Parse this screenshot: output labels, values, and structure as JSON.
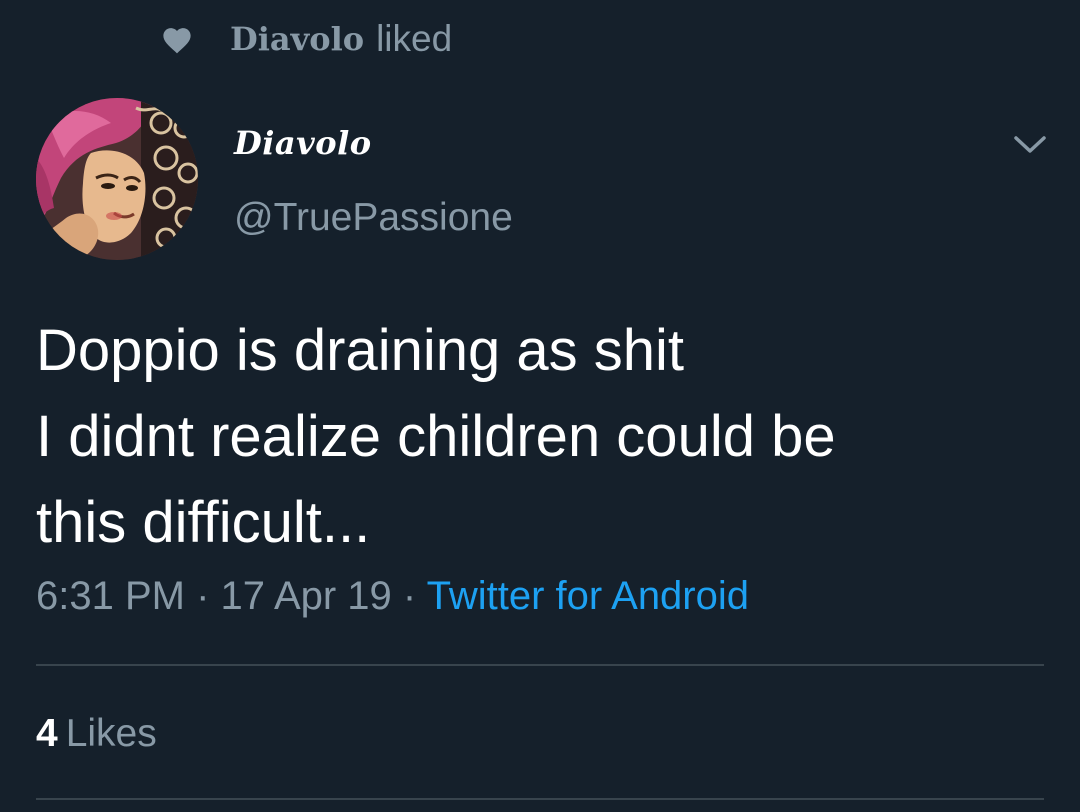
{
  "colors": {
    "background": "#15202b",
    "text_primary": "#ffffff",
    "text_secondary": "#8899a6",
    "link": "#1da1f2",
    "divider": "#38444d"
  },
  "social_context": {
    "icon": "heart-icon",
    "name": "Diavolo",
    "text": "liked"
  },
  "tweet": {
    "author": {
      "display_name": "Diavolo",
      "username": "@TruePassione",
      "avatar": "avatar"
    },
    "menu_icon": "chevron-down-icon",
    "lines": [
      "Doppio is draining as shit",
      "I didnt realize children could be",
      "this difficult..."
    ],
    "meta": {
      "time": "6:31 PM",
      "separator": "·",
      "date": "17 Apr 19",
      "source": "Twitter for Android"
    },
    "likes": {
      "count": "4",
      "label": "Likes"
    }
  }
}
